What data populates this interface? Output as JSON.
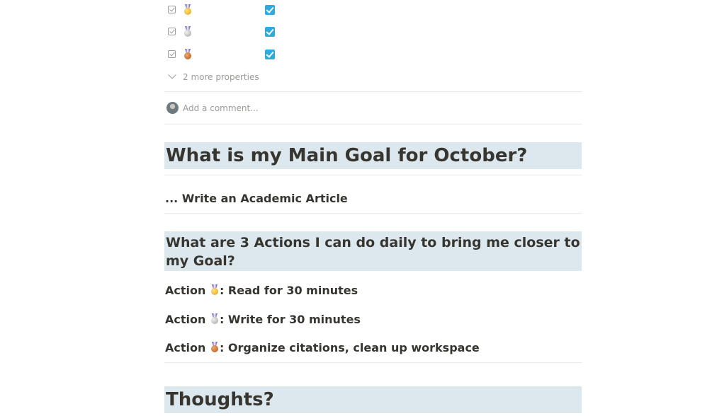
{
  "properties": {
    "rows": [
      {
        "icon": "gold-medal-icon"
      },
      {
        "icon": "silver-medal-icon"
      },
      {
        "icon": "bronze-medal-icon"
      }
    ],
    "more_label": "2 more properties"
  },
  "comment": {
    "placeholder": "Add a comment..."
  },
  "heading_main_goal": "What is my Main Goal for October?",
  "main_goal_text": "... Write an Academic Article",
  "heading_actions": "What are 3 Actions I can do daily to bring me closer to my Goal?",
  "actions": [
    {
      "prefix": "Action ",
      "medal": "gold-medal-icon",
      "text": ": Read for 30 minutes"
    },
    {
      "prefix": "Action ",
      "medal": "silver-medal-icon",
      "text": ": Write for 30 minutes"
    },
    {
      "prefix": "Action ",
      "medal": "bronze-medal-icon",
      "text": ": Organize citations, clean up workspace"
    }
  ],
  "heading_thoughts": "Thoughts?",
  "colors": {
    "checkbox": "#2eaadc",
    "heading_bg": "#dde8ee",
    "text": "#37352f",
    "muted": "#9b9a97"
  }
}
